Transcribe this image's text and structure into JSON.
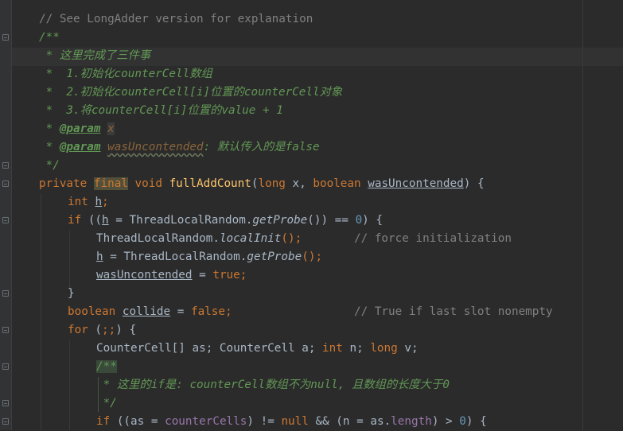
{
  "lines": {
    "l1": {
      "comment": "// See LongAdder version for explanation"
    },
    "l2": {
      "doc_open": "/**"
    },
    "l3": {
      "text": " * 这里完成了三件事"
    },
    "l4": {
      "text": " *  1.初始化counterCell数组"
    },
    "l5": {
      "text": " *  2.初始化counterCell[i]位置的counterCell对象"
    },
    "l6": {
      "text": " *  3.将counterCell[i]位置的value + 1"
    },
    "l7": {
      "star": " * ",
      "tag": "@param",
      "name": "x"
    },
    "l8": {
      "star": " * ",
      "tag": "@param",
      "name": "wasUncontended",
      "desc": ": 默认传入的是false"
    },
    "l9": {
      "doc_close": " */"
    },
    "l10": {
      "kw_private": "private",
      "kw_final": "final",
      "kw_void": "void",
      "fn": "fullAddCount",
      "open": "(",
      "kw_long": "long",
      "x": " x, ",
      "kw_boolean": "boolean",
      "param": "wasUncontended",
      "close": ") {"
    },
    "l11": {
      "kw": "int",
      "var": "h",
      "semi": ";"
    },
    "l12": {
      "kw_if": "if",
      "p1": " ((",
      "var": "h",
      "eq": " = ThreadLocalRandom.",
      "call": "getProbe",
      "p2": "()) == ",
      "num": "0",
      "p3": ") {"
    },
    "l13": {
      "cls": "ThreadLocalRandom.",
      "call": "localInit",
      "p": "();",
      "comment": "// force initialization"
    },
    "l14": {
      "var": "h",
      "eq": " = ThreadLocalRandom.",
      "call": "getProbe",
      "p": "();"
    },
    "l15": {
      "var": "wasUncontended",
      "eq": " = ",
      "kw": "true",
      "semi": ";"
    },
    "l16": {
      "brace": "}"
    },
    "l17": {
      "kw": "boolean",
      "var": "collide",
      "eq": " = ",
      "kw2": "false",
      "semi": ";",
      "comment": "// True if last slot nonempty"
    },
    "l18": {
      "kw": "for",
      "p1": " (",
      "semis": ";;",
      "p2": ") {"
    },
    "l19": {
      "t1": "CounterCell[] as; CounterCell a; ",
      "kw_int": "int",
      "t2": " n; ",
      "kw_long": "long",
      "t3": " v;"
    },
    "l20": {
      "doc_open": "/**"
    },
    "l21": {
      "text": " * 这里的if是: counterCell数组不为null, 且数组的长度大于0"
    },
    "l22": {
      "doc_close": " */"
    },
    "l23": {
      "kw_if": "if",
      "p1": " ((as = ",
      "field": "counterCells",
      "p2": ") != ",
      "kw_null": "null",
      "p3": " && (n = as.",
      "field2": "length",
      "p4": ") > ",
      "num": "0",
      "p5": ") {"
    }
  },
  "colors": {
    "background": "#2b2b2b",
    "keyword": "#cc7832",
    "method": "#ffc66d",
    "doc_comment": "#629755",
    "line_comment": "#808080",
    "number": "#6897bb",
    "field": "#9876aa",
    "text": "#a9b7c6"
  }
}
